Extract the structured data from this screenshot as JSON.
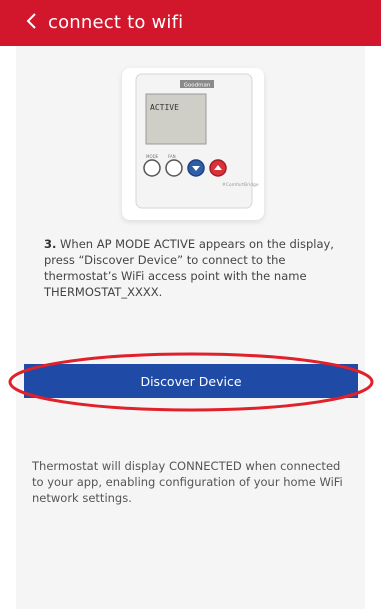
{
  "header": {
    "title": "connect to wifi",
    "back_icon": "chevron-left-icon",
    "background_color": "#d2162c"
  },
  "device_image": {
    "brand_label": "Goodman",
    "display_text": "ACTIVE",
    "buttons": [
      "mode-button",
      "fan-button",
      "down-arrow-button",
      "up-arrow-button"
    ],
    "footer_label": "#ComfortBridge"
  },
  "instruction": {
    "step_number": "3.",
    "text": " When AP MODE ACTIVE appears on the display, press “Discover Device” to connect to the thermostat’s WiFi access point with the name THERMOSTAT_XXXX."
  },
  "discover_button": {
    "label": "Discover Device",
    "color": "#1f4aa6"
  },
  "info": {
    "text": "Thermostat will display CONNECTED when connected to your app, enabling configuration of your home WiFi network settings."
  },
  "annotation": {
    "color": "#e0202a"
  }
}
